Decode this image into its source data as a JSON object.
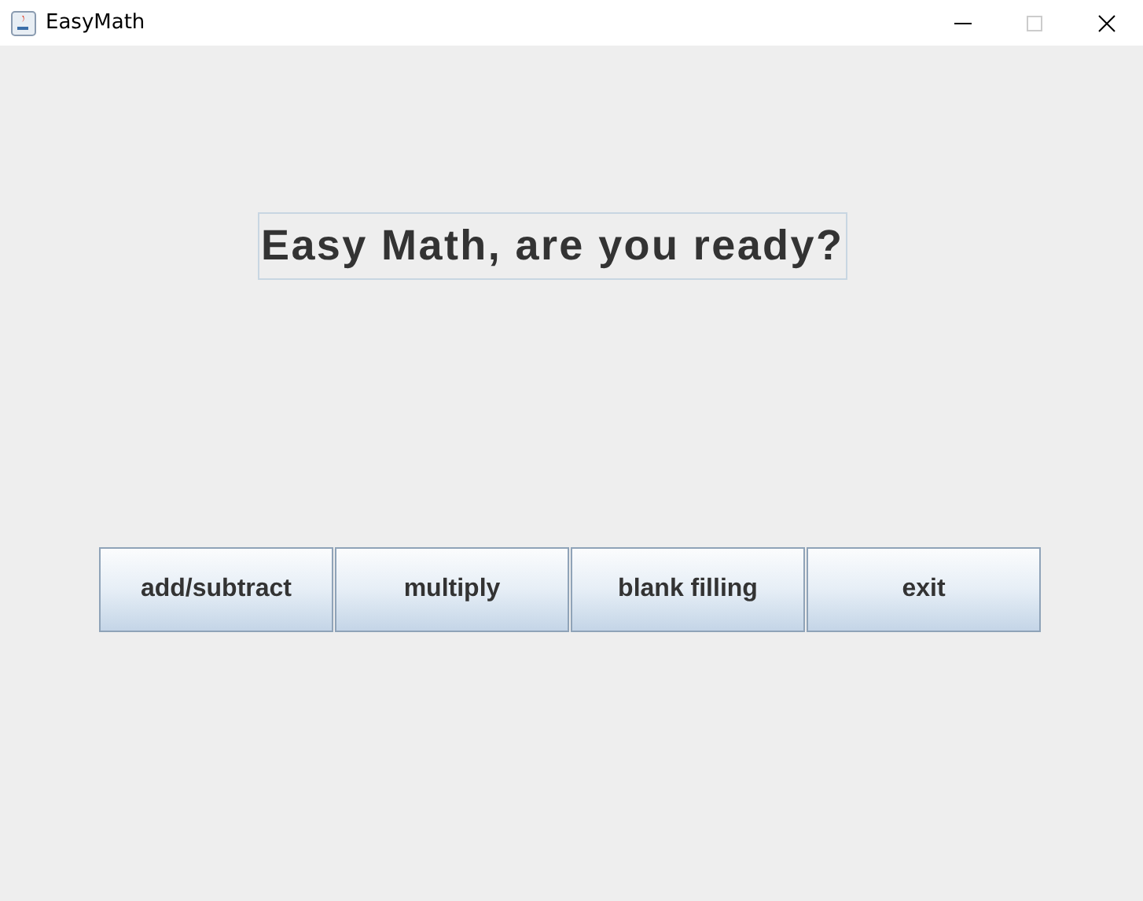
{
  "window": {
    "title": "EasyMath"
  },
  "heading": "Easy Math, are you ready?",
  "buttons": [
    "add/subtract",
    "multiply",
    "blank filling",
    "exit"
  ]
}
